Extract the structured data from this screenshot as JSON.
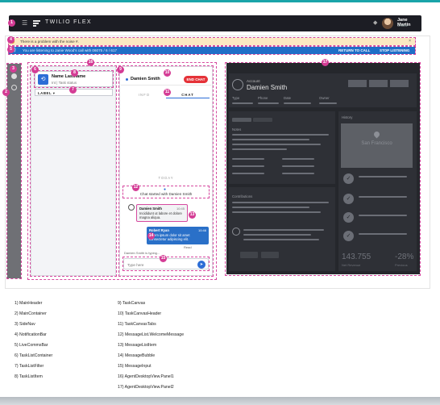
{
  "header": {
    "title": "TWILIO FLEX",
    "agent_name": "Jane Martin",
    "agent_status": "Online"
  },
  "notification": {
    "text": "There is a problem with the noise #.",
    "close": "×"
  },
  "live_comms": {
    "text": "You are listening to Janie Wood's call with 06075 / 6 / 617",
    "return_label": "RETURN TO CALL",
    "stop_label": "STOP LISTENING"
  },
  "task_list": {
    "item": {
      "name": "Name Lastname",
      "status": "Int | Task status"
    },
    "filter_label": "LABEL ▾"
  },
  "task_canvas": {
    "header_name": "Damien Smith",
    "end_chat": "END CHAT",
    "tabs": [
      "INFO",
      "CHAT"
    ],
    "active_tab": "CHAT",
    "day_label": "TODAY",
    "welcome": "Chat started with Damien Smith",
    "message1": {
      "author": "Damien Smith",
      "time": "10:45",
      "text": "Incididunt ut labore et dolore magna aliqua."
    },
    "message2": {
      "author": "Robert Ryan",
      "time": "10:46",
      "text": "Lorem ipsum dolor sit amet consectetur adipiscing elit."
    },
    "read_label": "Read",
    "typing": "Damien Smith is typing...",
    "input_placeholder": "Type here"
  },
  "panel2": {
    "account_label": "Account",
    "account_name": "Damien Smith",
    "field_labels": [
      "Type",
      "Phone",
      "Date",
      "Owner"
    ],
    "notes_label": "Notes",
    "history_label": "History",
    "contributions_label": "Contributions",
    "map_city": "San Francisco",
    "stat1_value": "143.755",
    "stat1_label": "Net Revenue",
    "stat2_value": "-28%",
    "stat2_label": "Previous"
  },
  "legend_left": [
    "1) MainHeader",
    "2) MainContainer",
    "3) SideNav",
    "4) NotificationBar",
    "5) LiveCommsBar",
    "6) TaskListContainer",
    "7) TaskListFilter",
    "8) TaskListItem"
  ],
  "legend_right": [
    "9) TaskCanvas",
    "10) TaskCanvasHeader",
    "11) TaskCanvasTabs",
    "12) MessageList.WelcomeMessage",
    "13) MessageListItem",
    "14) MessageBubble",
    "15) MessageInput",
    "16) AgentDesktopView.Panel1",
    "17) AgentDesktopView.Panel2"
  ],
  "callouts": [
    "1",
    "2",
    "3",
    "4",
    "5",
    "6",
    "7",
    "8",
    "9",
    "10",
    "11",
    "12",
    "13",
    "14",
    "15",
    "16",
    "17"
  ]
}
